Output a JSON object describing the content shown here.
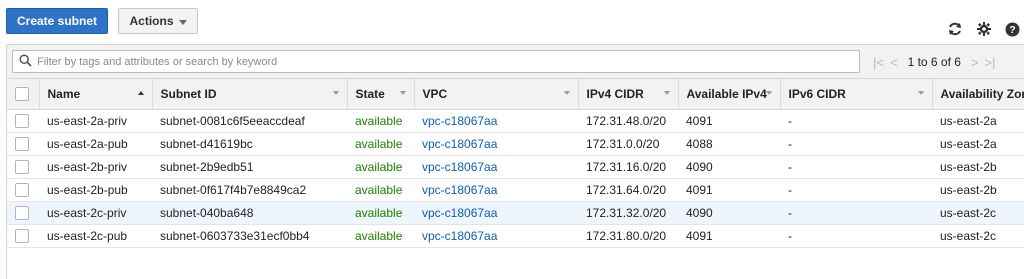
{
  "toolbar": {
    "create_label": "Create subnet",
    "actions_label": "Actions"
  },
  "filter": {
    "placeholder": "Filter by tags and attributes or search by keyword"
  },
  "pagination": {
    "text": "1 to 6 of 6"
  },
  "columns": [
    "Name",
    "Subnet ID",
    "State",
    "VPC",
    "IPv4 CIDR",
    "Available IPv4",
    "IPv6 CIDR",
    "Availability Zone"
  ],
  "rows": [
    {
      "name": "us-east-2a-priv",
      "subnet_id": "subnet-0081c6f5eeaccdeaf",
      "state": "available",
      "vpc": "vpc-c18067aa",
      "ipv4": "172.31.48.0/20",
      "avail": "4091",
      "ipv6": "-",
      "az": "us-east-2a"
    },
    {
      "name": "us-east-2a-pub",
      "subnet_id": "subnet-d41619bc",
      "state": "available",
      "vpc": "vpc-c18067aa",
      "ipv4": "172.31.0.0/20",
      "avail": "4088",
      "ipv6": "-",
      "az": "us-east-2a"
    },
    {
      "name": "us-east-2b-priv",
      "subnet_id": "subnet-2b9edb51",
      "state": "available",
      "vpc": "vpc-c18067aa",
      "ipv4": "172.31.16.0/20",
      "avail": "4090",
      "ipv6": "-",
      "az": "us-east-2b"
    },
    {
      "name": "us-east-2b-pub",
      "subnet_id": "subnet-0f617f4b7e8849ca2",
      "state": "available",
      "vpc": "vpc-c18067aa",
      "ipv4": "172.31.64.0/20",
      "avail": "4091",
      "ipv6": "-",
      "az": "us-east-2b"
    },
    {
      "name": "us-east-2c-priv",
      "subnet_id": "subnet-040ba648",
      "state": "available",
      "vpc": "vpc-c18067aa",
      "ipv4": "172.31.32.0/20",
      "avail": "4090",
      "ipv6": "-",
      "az": "us-east-2c"
    },
    {
      "name": "us-east-2c-pub",
      "subnet_id": "subnet-0603733e31ecf0bb4",
      "state": "available",
      "vpc": "vpc-c18067aa",
      "ipv4": "172.31.80.0/20",
      "avail": "4091",
      "ipv6": "-",
      "az": "us-east-2c"
    }
  ],
  "colors": {
    "primary": "#2f73c8",
    "available": "#1d8102",
    "link": "#0b5cb8"
  },
  "icons": [
    "refresh-icon",
    "settings-gear-icon",
    "help-icon",
    "search-icon",
    "first-page-icon",
    "prev-page-icon",
    "next-page-icon",
    "last-page-icon"
  ]
}
